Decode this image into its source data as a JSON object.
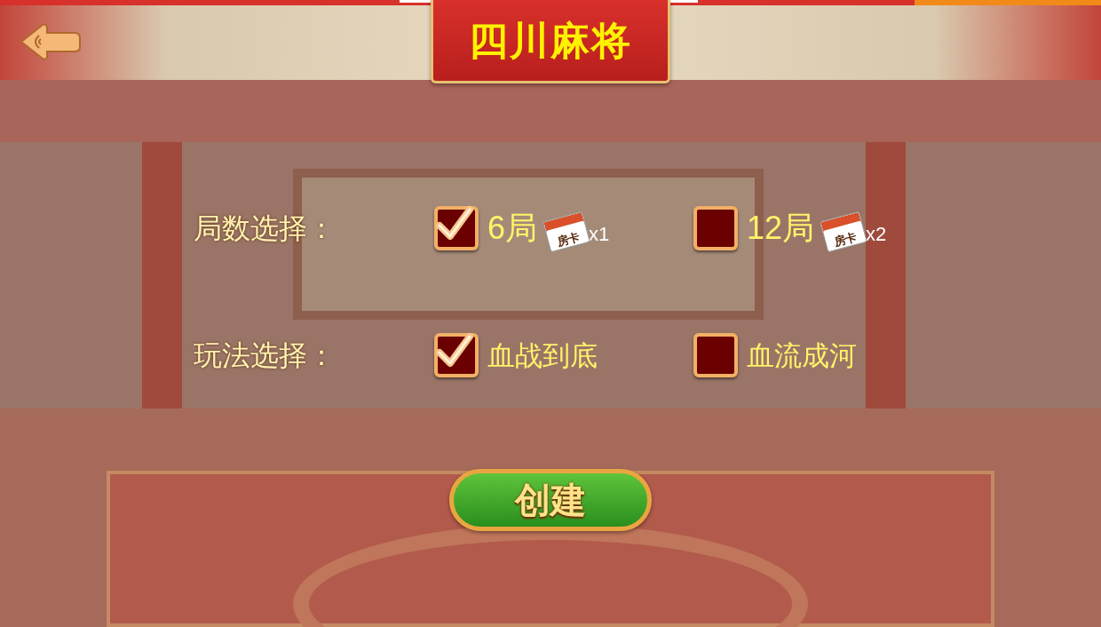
{
  "title": "四川麻将",
  "options": [
    {
      "label": "局数选择：",
      "choices": [
        {
          "text": "6局",
          "selected": true,
          "card": {
            "label": "房卡",
            "count": "x1"
          }
        },
        {
          "text": "12局",
          "selected": false,
          "card": {
            "label": "房卡",
            "count": "x2"
          }
        }
      ]
    },
    {
      "label": "玩法选择：",
      "choices": [
        {
          "text": "血战到底",
          "selected": true
        },
        {
          "text": "血流成河",
          "selected": false
        }
      ]
    }
  ],
  "create_button": "创建"
}
